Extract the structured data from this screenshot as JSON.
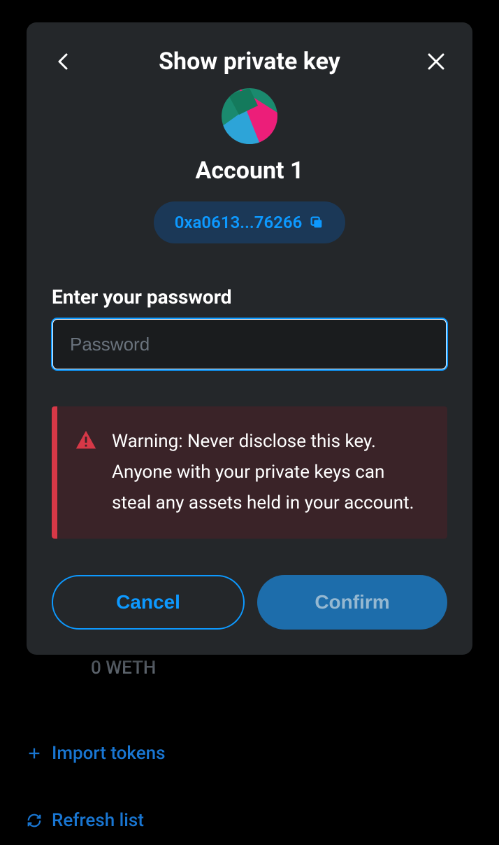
{
  "modal": {
    "title": "Show private key",
    "account_name": "Account 1",
    "address": "0xa0613...76266",
    "password_label": "Enter your password",
    "password_placeholder": "Password",
    "warning_text": "Warning: Never disclose this key. Anyone with your private keys can steal any assets held in your account.",
    "cancel_label": "Cancel",
    "confirm_label": "Confirm"
  },
  "background": {
    "weth_balance": "0 WETH",
    "import_tokens_label": "Import tokens",
    "refresh_list_label": "Refresh list"
  }
}
